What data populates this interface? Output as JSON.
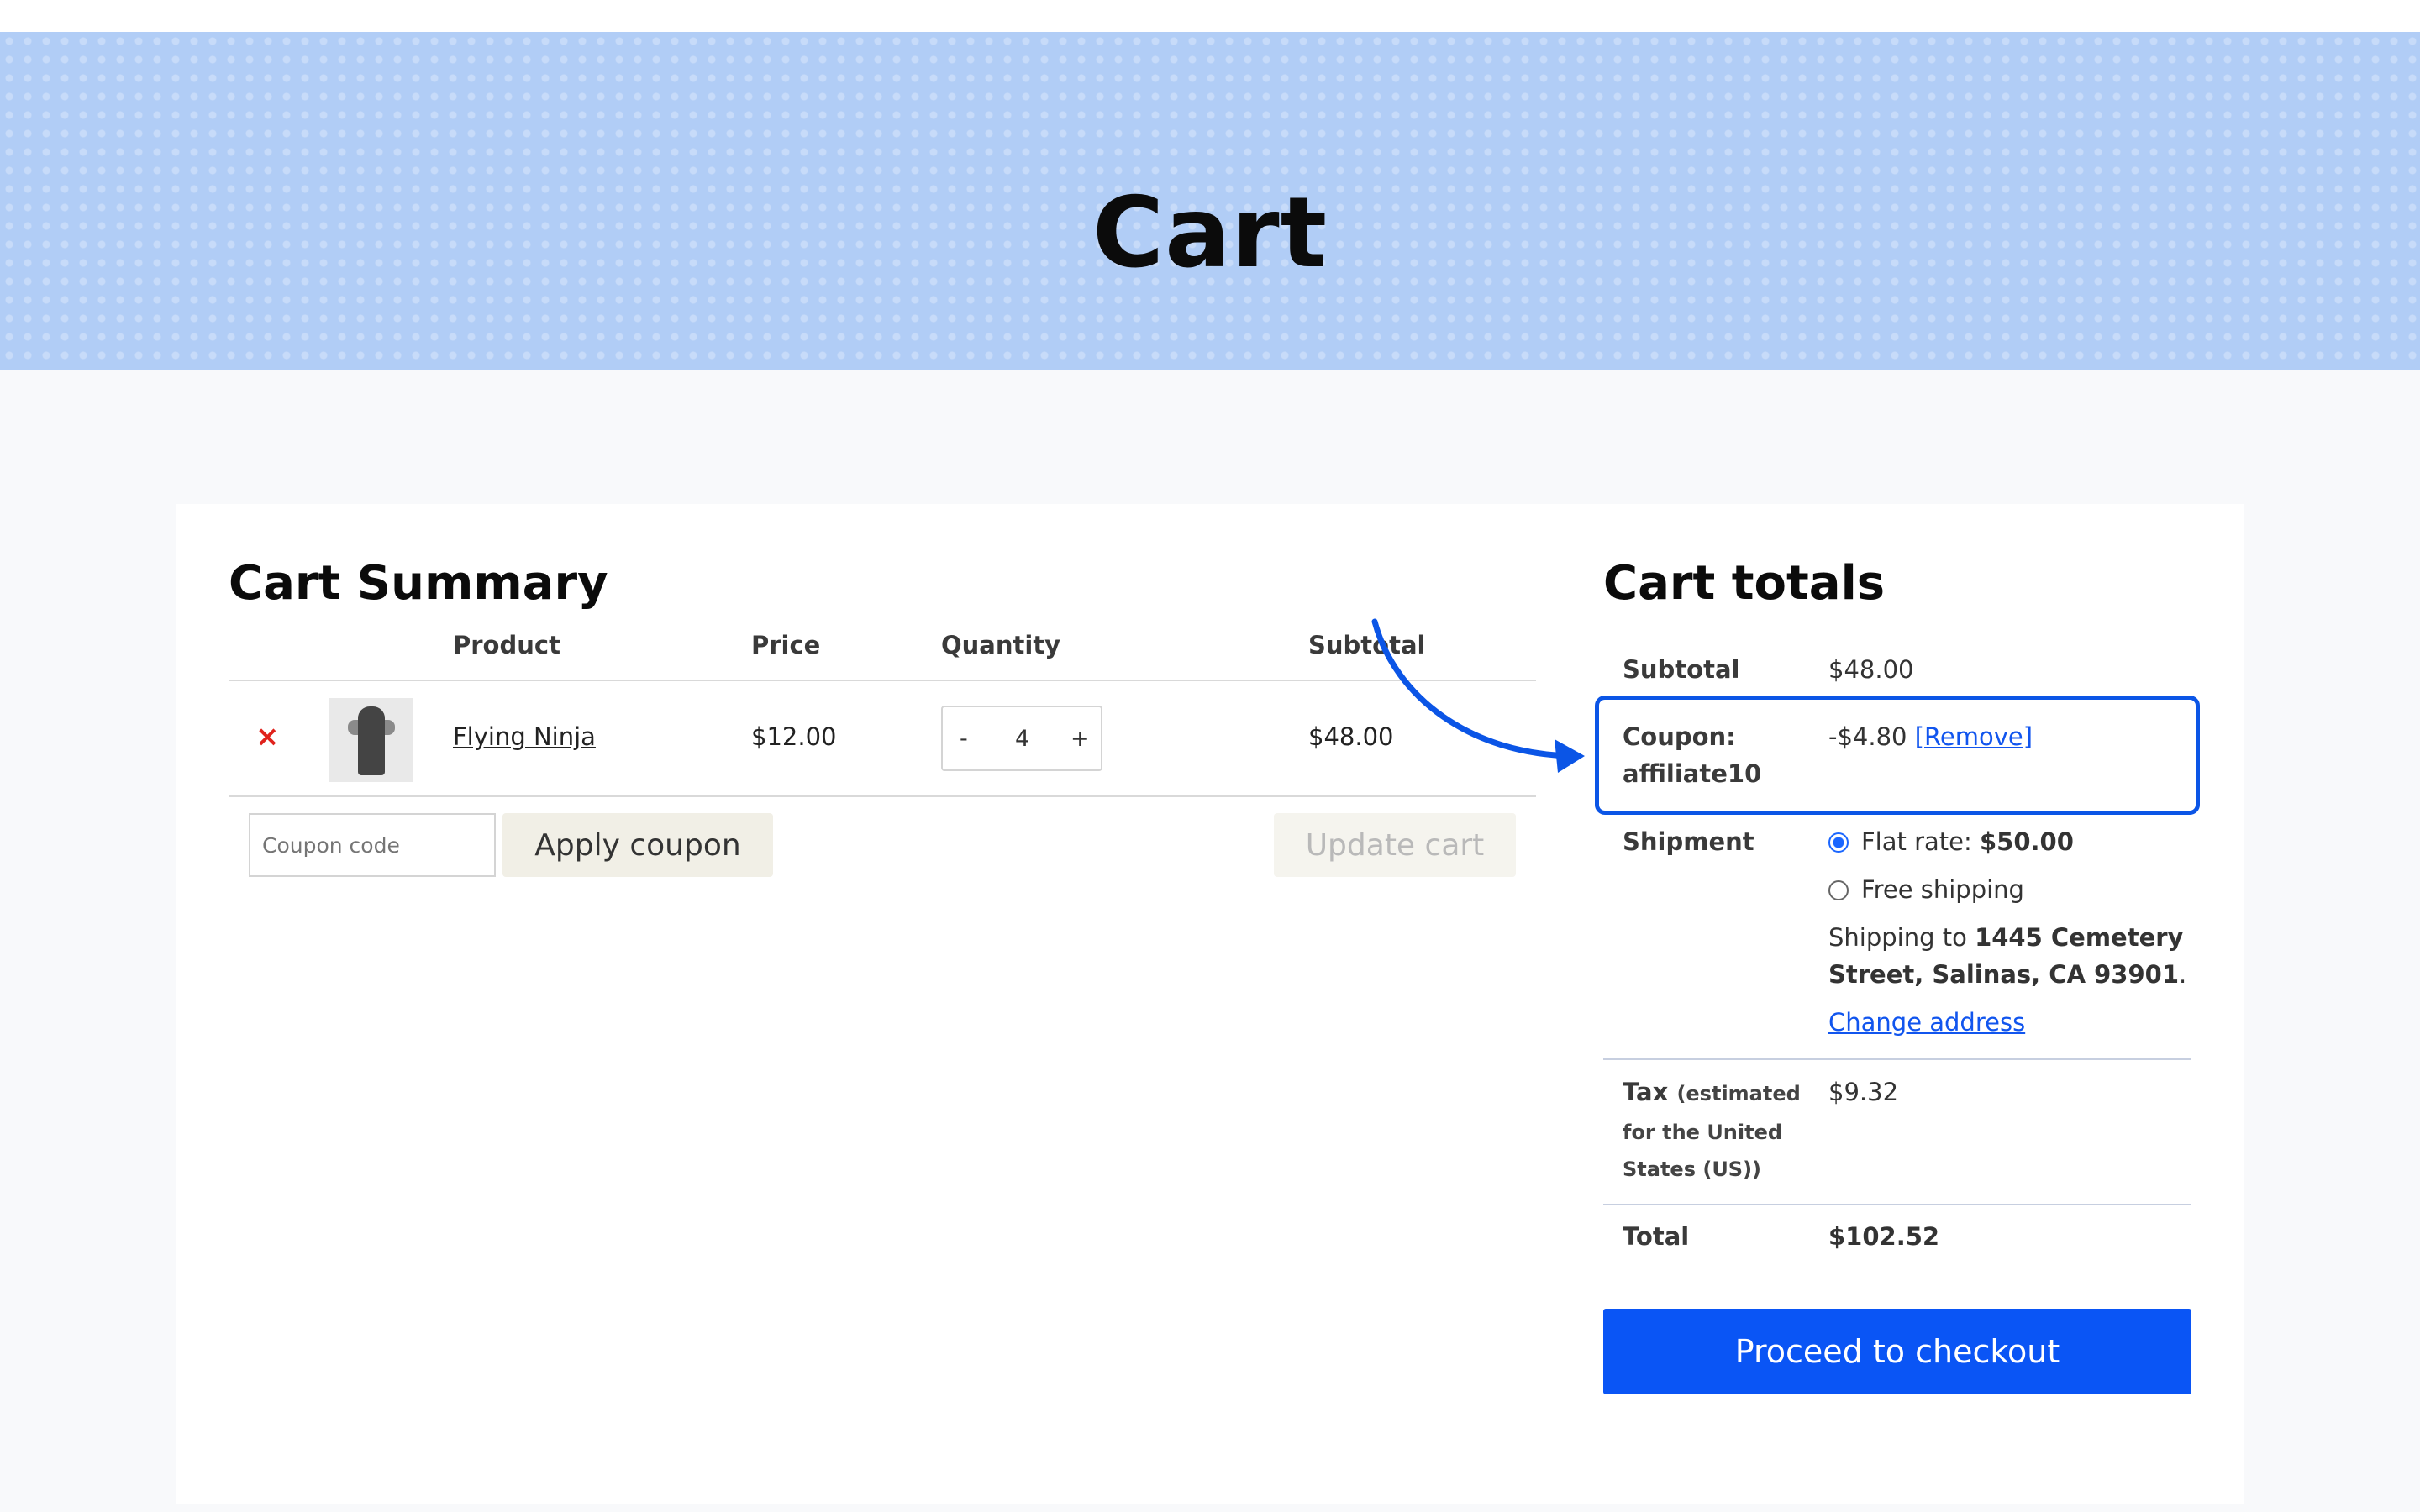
{
  "banner": {
    "title": "Cart"
  },
  "summary": {
    "heading": "Cart Summary",
    "columns": [
      "Product",
      "Price",
      "Quantity",
      "Subtotal"
    ],
    "rows": [
      {
        "remove": "×",
        "product": "Flying Ninja",
        "price": "$12.00",
        "quantity": "4",
        "subtotal": "$48.00"
      }
    ],
    "qty_minus": "-",
    "qty_plus": "+",
    "coupon_placeholder": "Coupon code",
    "apply_label": "Apply coupon",
    "update_label": "Update cart"
  },
  "totals": {
    "heading": "Cart totals",
    "subtotal_label": "Subtotal",
    "subtotal_value": "$48.00",
    "coupon_label_1": "Coupon:",
    "coupon_label_2": "affiliate10",
    "coupon_value": "-$4.80",
    "coupon_remove": "[Remove]",
    "shipment_label": "Shipment",
    "flat_rate_label": "Flat rate:",
    "flat_rate_value": "$50.00",
    "free_shipping_label": "Free shipping",
    "shipping_to_prefix": "Shipping to",
    "shipping_address_1": "1445 Cemetery",
    "shipping_address_2": "Street, Salinas, CA 93901",
    "shipping_to_suffix": ".",
    "change_address": "Change address",
    "tax_label": "Tax",
    "tax_note_1": "(estimated",
    "tax_note_2": "for the United",
    "tax_note_3": "States (US))",
    "tax_value": "$9.32",
    "total_label": "Total",
    "total_value": "$102.52",
    "checkout_label": "Proceed to checkout"
  },
  "colors": {
    "banner": "#b1cdf6",
    "accent": "#0a55f5",
    "remove": "#e0221c",
    "annotation": "#0b55e6"
  }
}
